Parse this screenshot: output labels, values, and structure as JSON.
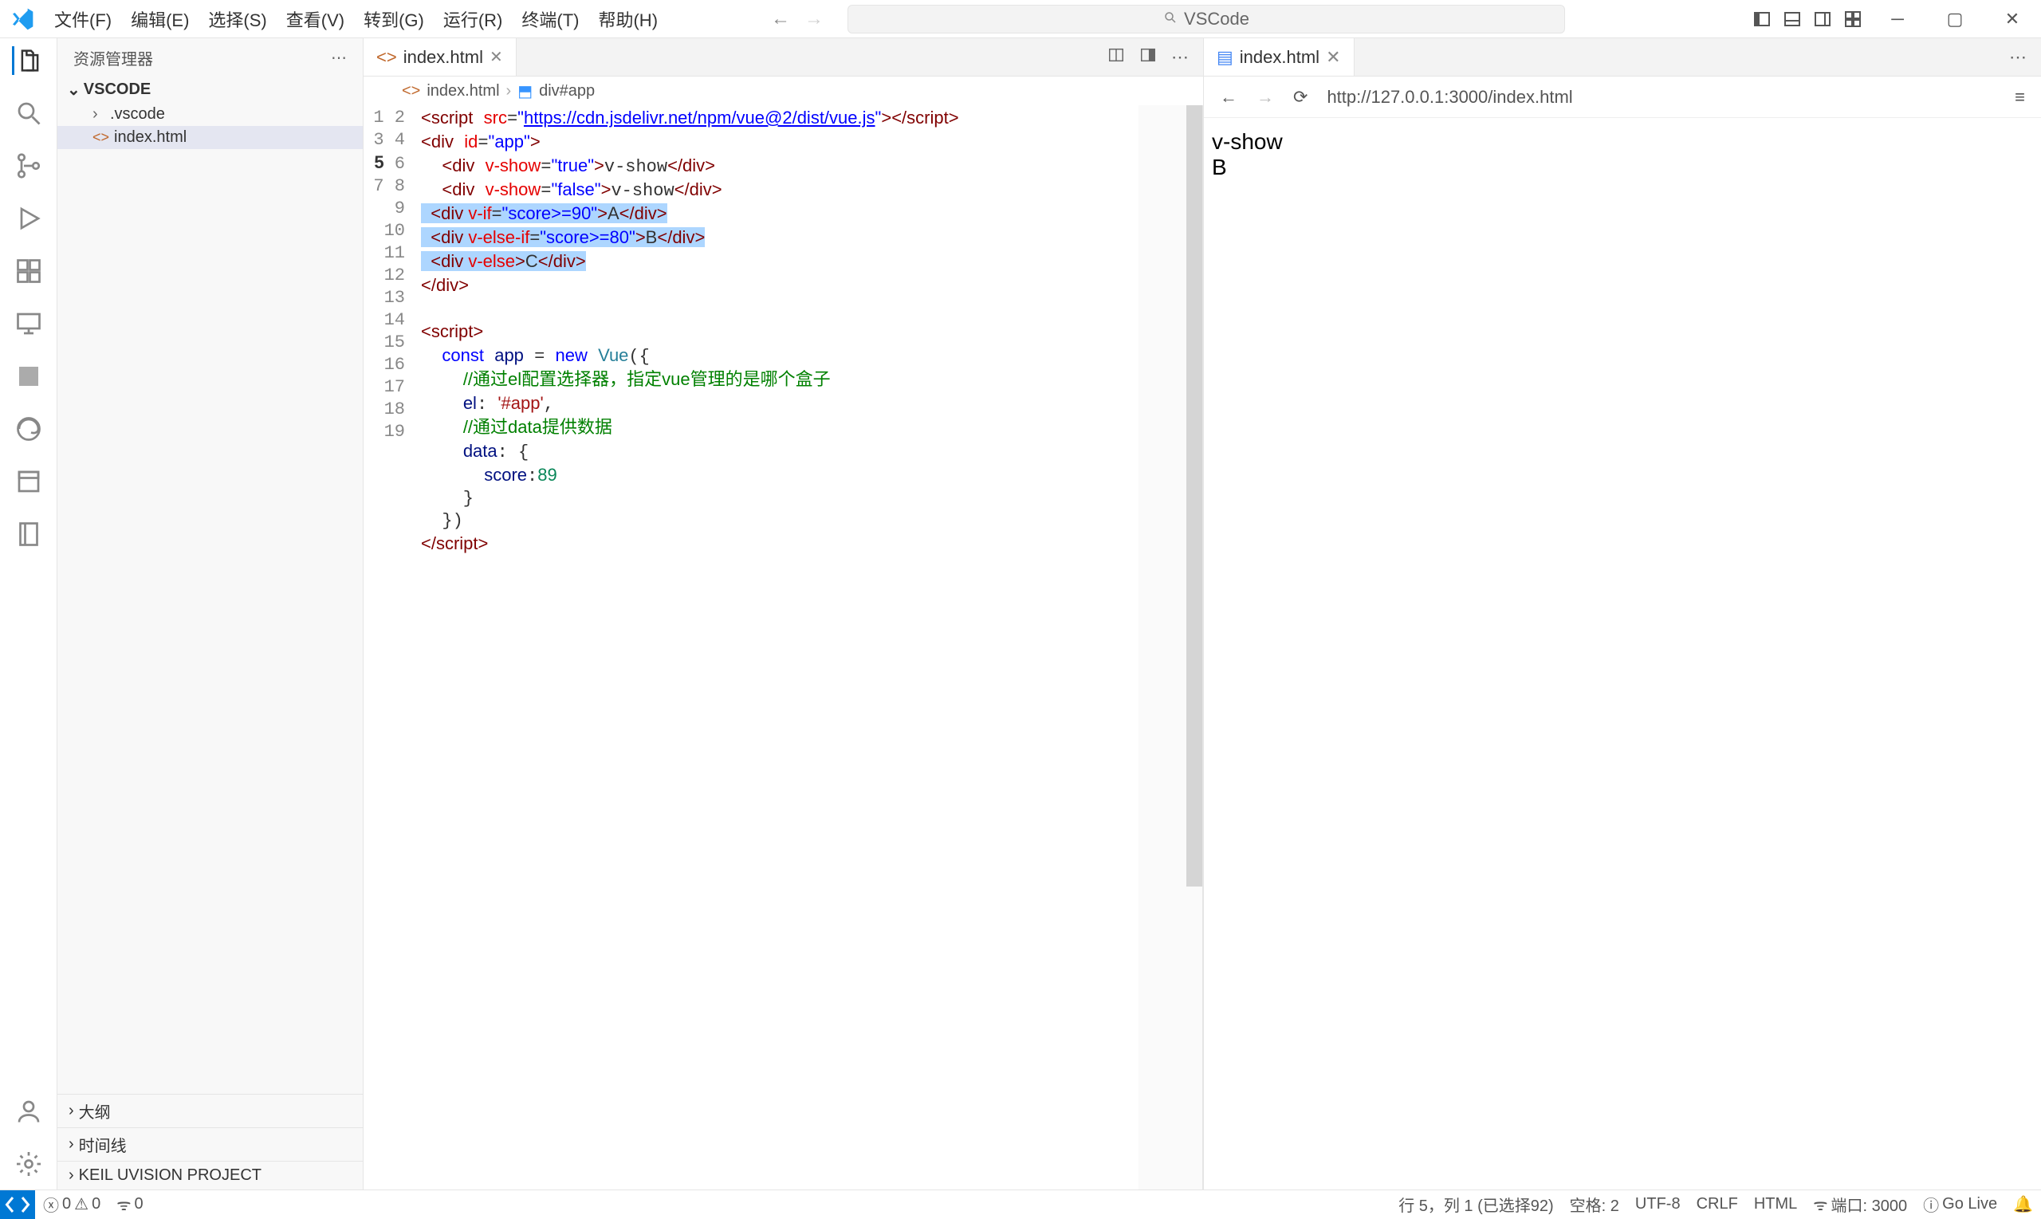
{
  "menu": {
    "file": "文件(F)",
    "edit": "编辑(E)",
    "selection": "选择(S)",
    "view": "查看(V)",
    "go": "转到(G)",
    "run": "运行(R)",
    "terminal": "终端(T)",
    "help": "帮助(H)"
  },
  "search_placeholder": "VSCode",
  "sidebar": {
    "title": "资源管理器",
    "root": "VSCODE",
    "items": [
      {
        "label": ".vscode"
      },
      {
        "label": "index.html"
      }
    ],
    "outline": "大纲",
    "timeline": "时间线",
    "keil": "KEIL UVISION PROJECT"
  },
  "tab": {
    "label": "index.html"
  },
  "breadcrumb": {
    "file": "index.html",
    "symbol": "div#app"
  },
  "code_lines": [
    "<script src=\"https://cdn.jsdelivr.net/npm/vue@2/dist/vue.js\"></script>",
    "<div id=\"app\">",
    "  <div v-show=\"true\">v-show</div>",
    "  <div v-show=\"false\">v-show</div>",
    "  <div v-if=\"score>=90\">A</div>",
    "  <div v-else-if=\"score>=80\">B</div>",
    "  <div v-else>C</div>",
    "</div>",
    "",
    "<script>",
    "  const app = new Vue({",
    "    //通过el配置选择器，指定vue管理的是哪个盒子",
    "    el: '#app',",
    "    //通过data提供数据",
    "    data: {",
    "      score:89",
    "    }",
    "  })",
    "</script>"
  ],
  "preview": {
    "tab": "index.html",
    "url": "http://127.0.0.1:3000/index.html",
    "content": [
      "v-show",
      "B"
    ]
  },
  "status": {
    "errors": "0",
    "warnings": "0",
    "ports": "0",
    "cursor": "行 5，列 1 (已选择92)",
    "spaces": "空格: 2",
    "encoding": "UTF-8",
    "eol": "CRLF",
    "lang": "HTML",
    "port": "端口: 3000",
    "golive": "Go Live"
  }
}
